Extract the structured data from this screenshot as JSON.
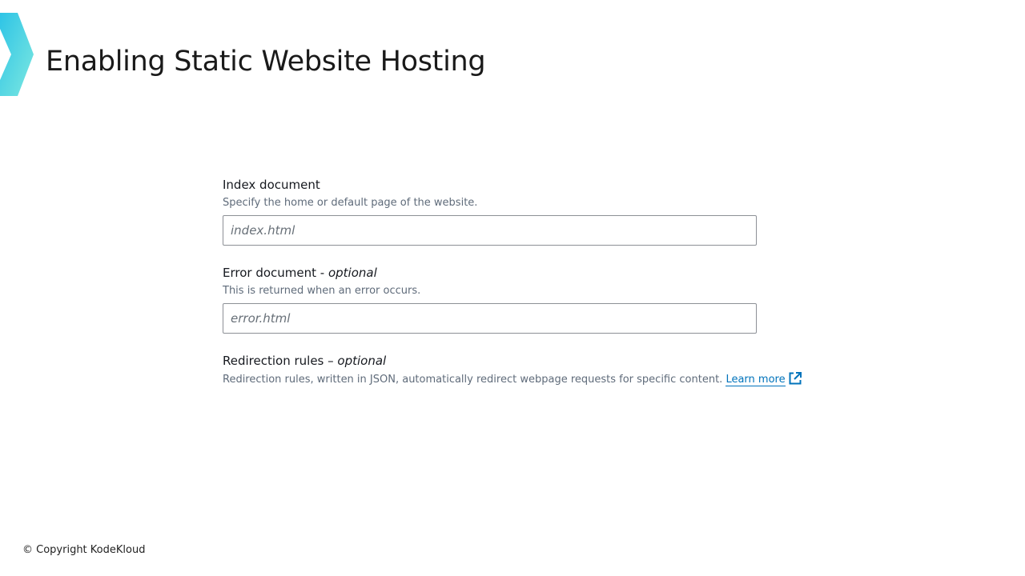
{
  "slide": {
    "title": "Enabling Static Website Hosting",
    "accent_colors": [
      "#2ec4e6",
      "#7de8e0"
    ],
    "logo_icon": "chevron-right-icon"
  },
  "form": {
    "index": {
      "label": "Index document",
      "description": "Specify the home or default page of the website.",
      "placeholder": "index.html",
      "value": ""
    },
    "error": {
      "label": "Error document - ",
      "label_optional": "optional",
      "description": "This is returned when an error occurs.",
      "placeholder": "error.html",
      "value": ""
    },
    "redirect": {
      "label": "Redirection rules – ",
      "label_optional": "optional",
      "description": "Redirection rules, written in JSON, automatically redirect webpage requests for specific content. ",
      "link_text": "Learn more",
      "link_icon": "external-link-icon",
      "link_color": "#0073bb"
    }
  },
  "footer": {
    "copyright": "© Copyright KodeKloud"
  }
}
